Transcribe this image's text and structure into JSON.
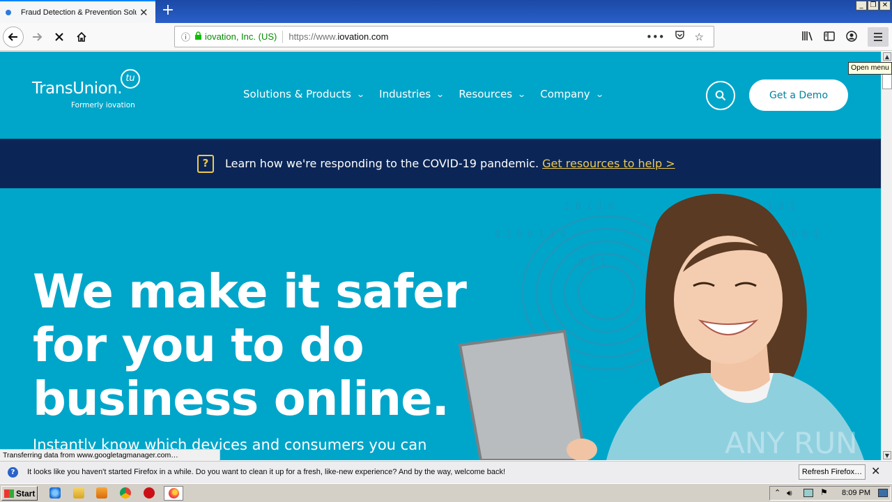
{
  "browser": {
    "tab_title": "Fraud Detection & Prevention Solutions",
    "url_org": "iovation, Inc. (US)",
    "url_prefix": "https://www.",
    "url_domain": "iovation.com",
    "status_text": "Transferring data from www.googletagmanager.com…",
    "tooltip": "Open menu"
  },
  "site": {
    "logo_text": "TransUnion.",
    "logo_badge": "tu",
    "logo_sub": "Formerly iovation",
    "nav": [
      {
        "label": "Solutions & Products"
      },
      {
        "label": "Industries"
      },
      {
        "label": "Resources"
      },
      {
        "label": "Company"
      }
    ],
    "demo_label": "Get a Demo",
    "covid_icon": "?",
    "covid_text": "Learn how we're responding to the COVID-19 pandemic. ",
    "covid_link": "Get resources to help >",
    "hero_title": "We make it safer for you to do business online.",
    "hero_sub": "Instantly know which devices and consumers you can",
    "watermark": "ANY RUN"
  },
  "notification": {
    "message": "It looks like you haven't started Firefox in a while. Do you want to clean it up for a fresh, like-new experience? And by the way, welcome back!",
    "button": "Refresh Firefox…"
  },
  "taskbar": {
    "start_label": "Start",
    "clock": "8:09 PM"
  },
  "colors": {
    "brand_teal": "#00a6ca",
    "banner_navy": "#0b2656",
    "link_yellow": "#f2c94c"
  }
}
